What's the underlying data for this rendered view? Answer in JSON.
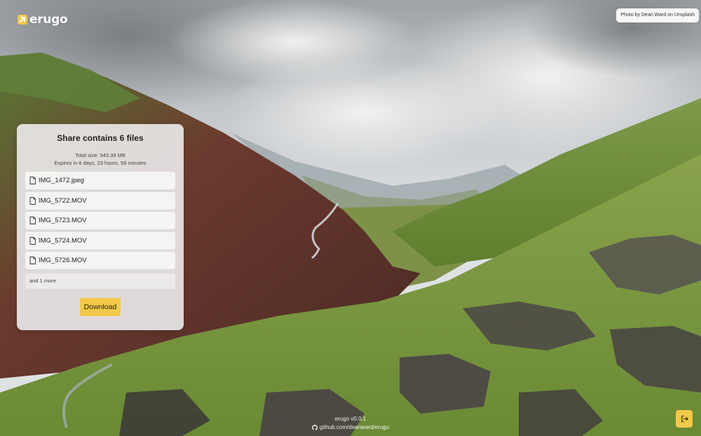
{
  "header": {
    "logo_text": "erugo"
  },
  "background": {
    "credit": "Photo by Dean Ward on Unsplash"
  },
  "share": {
    "title": "Share contains 6 files",
    "total_size": "Total size: 543.39 MB",
    "expires": "Expires in 6 days, 23 hours, 59 minutes",
    "files": [
      {
        "name": "IMG_1472.jpeg"
      },
      {
        "name": "IMG_5722.MOV"
      },
      {
        "name": "IMG_5723.MOV"
      },
      {
        "name": "IMG_5724.MOV"
      },
      {
        "name": "IMG_5726.MOV"
      }
    ],
    "more_label": "and 1 more",
    "download_label": "Download"
  },
  "footer": {
    "version": "erugo v0.0.1",
    "repo": "github.com/deanward/erugo"
  },
  "colors": {
    "accent": "#f2c94a",
    "panel": "#e8e6e6"
  },
  "icons": {
    "file": "file-icon",
    "logo": "erugo-arrow-icon",
    "github": "github-icon",
    "logout": "logout-icon"
  }
}
